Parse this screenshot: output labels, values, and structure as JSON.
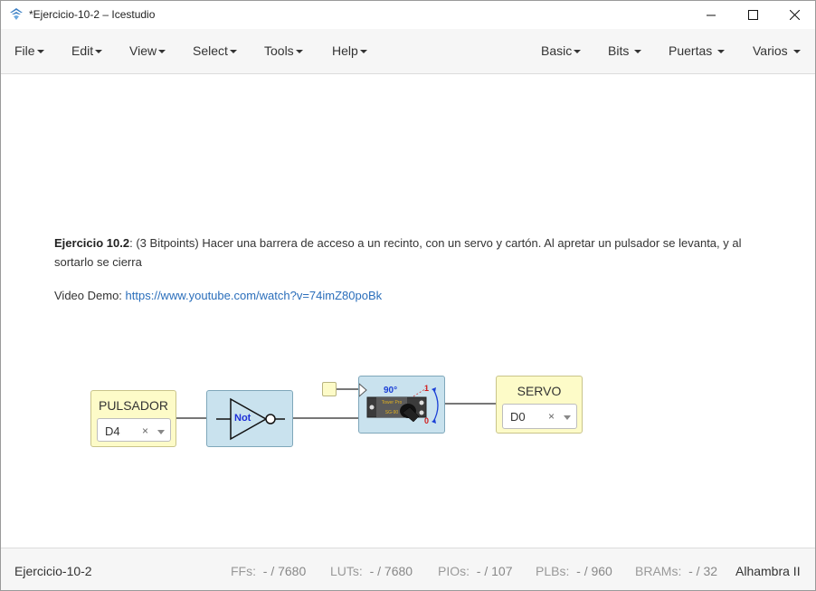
{
  "window": {
    "title": "*Ejercicio-10-2 – Icestudio",
    "minimize_icon": "minimize-icon",
    "maximize_icon": "maximize-icon",
    "close_icon": "close-icon"
  },
  "menu": {
    "left": [
      {
        "label": "File"
      },
      {
        "label": "Edit"
      },
      {
        "label": "View"
      },
      {
        "label": "Select"
      },
      {
        "label": "Tools"
      },
      {
        "label": "Help"
      }
    ],
    "right": [
      {
        "label": "Basic"
      },
      {
        "label": "Bits"
      },
      {
        "label": "Puertas"
      },
      {
        "label": "Varios"
      }
    ]
  },
  "comment": {
    "bold": "Ejercicio 10.2",
    "text": ": (3 Bitpoints) Hacer una barrera de acceso a un recinto, con un servo y cartón. Al apretar un pulsador se levanta, y al sortarlo se cierra",
    "demo_label": "Video Demo: ",
    "demo_link": "https://www.youtube.com/watch?v=74imZ80poBk"
  },
  "blocks": {
    "input": {
      "label": "PULSADOR",
      "pin": "D4"
    },
    "not_gate": {
      "label": "Not"
    },
    "servo": {
      "angle": "90°",
      "brand": "Tower Pro",
      "model": "SG-90",
      "top_value": "1",
      "bottom_value": "0"
    },
    "output": {
      "label": "SERVO",
      "pin": "D0"
    },
    "clear_symbol": "×"
  },
  "status": {
    "project": "Ejercicio-10-2",
    "ffs_label": "FFs:",
    "ffs_value": "- / 7680",
    "luts_label": "LUTs:",
    "luts_value": "- / 7680",
    "pios_label": "PIOs:",
    "pios_value": "- / 107",
    "plbs_label": "PLBs:",
    "plbs_value": "- / 960",
    "brams_label": "BRAMs:",
    "brams_value": "- / 32",
    "board": "Alhambra II"
  },
  "colors": {
    "io_block": "#fdfbc8",
    "gate_block": "#c9e2ee",
    "link": "#2a6ebb"
  }
}
